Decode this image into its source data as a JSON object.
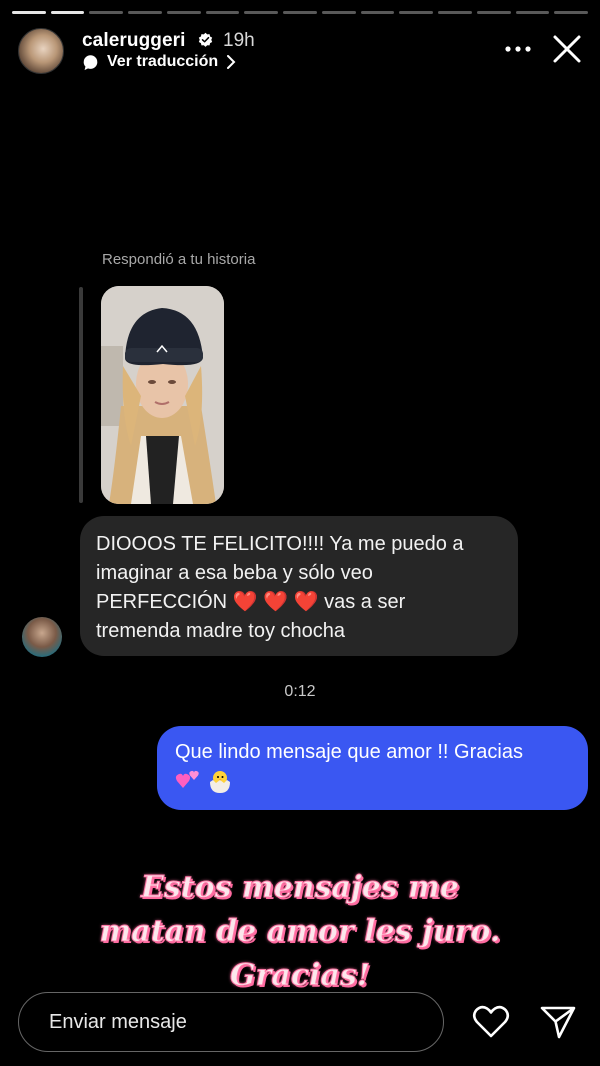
{
  "story": {
    "progress_segments_total": 15,
    "progress_segments_done": 2
  },
  "header": {
    "username": "caleruggeri",
    "time_ago": "19h",
    "translate_label": "Ver traducción"
  },
  "reply": {
    "replied_label": "Respondió a tu historia"
  },
  "incoming": {
    "line1": "DIOOOS TE FELICITO!!!! Ya me puedo a",
    "line2": "imaginar a esa beba y sólo veo",
    "line3_prefix": "PERFECCIÓN",
    "line3_suffix": "vas a ser",
    "line4": "tremenda madre toy chocha"
  },
  "timestamp": "0:12",
  "outgoing": {
    "text": "Que lindo mensaje que amor !! Gracias"
  },
  "caption": {
    "line1": "Estos mensajes me",
    "line2": "matan de amor les juro.",
    "line3": "Gracias!"
  },
  "footer": {
    "input_placeholder": "Enviar mensaje"
  },
  "colors": {
    "outgoing_bubble": "#3a57f2",
    "incoming_bubble": "#262626",
    "caption_stroke": "#ff7aa8"
  }
}
